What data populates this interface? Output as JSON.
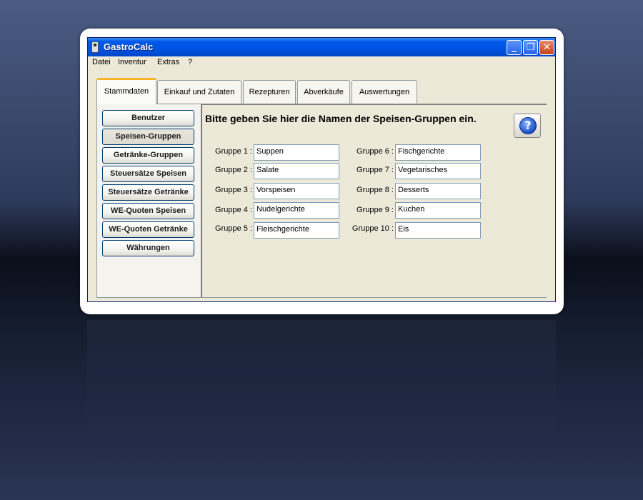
{
  "window": {
    "title": "GastroCalc"
  },
  "titlebar_buttons": {
    "minimize": "_",
    "maximize": "❐",
    "close": "✕"
  },
  "menu": [
    "Datei",
    "Inventur",
    "Extras",
    "?"
  ],
  "tabs": [
    {
      "label": "Stammdaten",
      "active": true
    },
    {
      "label": "Einkauf und Zutaten",
      "active": false
    },
    {
      "label": "Rezepturen",
      "active": false
    },
    {
      "label": "Abverkäufe",
      "active": false
    },
    {
      "label": "Auswertungen",
      "active": false
    }
  ],
  "nav_buttons": [
    {
      "label": "Benutzer"
    },
    {
      "label": "Speisen-Gruppen",
      "active": true
    },
    {
      "label": "Getränke-Gruppen"
    },
    {
      "label": "Steuersätze Speisen"
    },
    {
      "label": "Steuersätze Getränke"
    },
    {
      "label": "WE-Quoten Speisen"
    },
    {
      "label": "WE-Quoten Getränke"
    },
    {
      "label": "Währungen"
    }
  ],
  "content": {
    "heading": "Bitte geben Sie hier die Namen der Speisen-Gruppen ein.",
    "help_label": "?",
    "groups": [
      {
        "label": "Gruppe 1 :",
        "value": "Suppen"
      },
      {
        "label": "Gruppe 2 :",
        "value": "Salate"
      },
      {
        "label": "Gruppe 3 :",
        "value": "Vorspeisen"
      },
      {
        "label": "Gruppe 4 :",
        "value": "Nudelgerichte"
      },
      {
        "label": "Gruppe 5 :",
        "value": "Fleischgerichte"
      },
      {
        "label": "Gruppe 6 :",
        "value": "Fischgerichte"
      },
      {
        "label": "Gruppe 7 :",
        "value": "Vegetarisches"
      },
      {
        "label": "Gruppe 8 :",
        "value": "Desserts"
      },
      {
        "label": "Gruppe 9 :",
        "value": "Kuchen"
      },
      {
        "label": "Gruppe 10 :",
        "value": "Eis"
      }
    ]
  },
  "colors": {
    "titlebar": "#0054e3",
    "window_bg": "#ece9d8",
    "tab_highlight": "#f7b32a",
    "field_border": "#7f9db9"
  }
}
